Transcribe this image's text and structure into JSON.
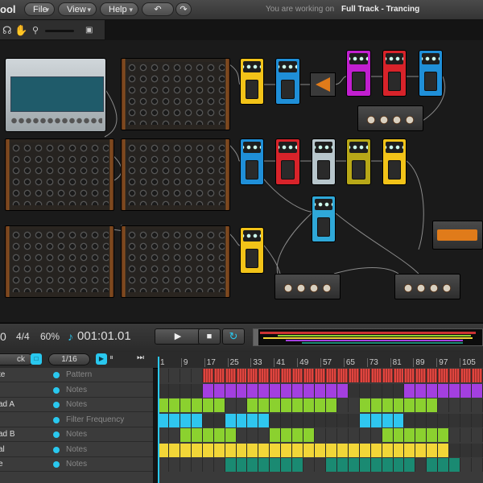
{
  "app": {
    "name": "ool"
  },
  "menu": {
    "file": "File",
    "view": "View",
    "help": "Help",
    "undo_icon": "undo-icon",
    "redo_icon": "redo-icon"
  },
  "status": {
    "prefix": "You are working on",
    "track": "Full Track - Trancing"
  },
  "tools": {
    "icons": [
      "headphones-icon",
      "hand-icon",
      "zoom-icon",
      "trash-icon"
    ]
  },
  "devices": {
    "synth_label": "—",
    "colors": {
      "yellow": "#f2c318",
      "blue": "#1f8fd8",
      "red": "#d8232a",
      "magenta": "#c21fd0",
      "orange": "#e07b1a",
      "cyan": "#2fa8d8",
      "olive": "#b8a818",
      "silver": "#b8c6cc"
    }
  },
  "transport": {
    "position_prefix": "0",
    "signature": "4/4",
    "zoom": "60%",
    "time": "001:01.01",
    "play_icon": "play-icon",
    "stop_icon": "stop-icon",
    "loop_icon": "loop-icon"
  },
  "seqbar": {
    "back_label": "ck",
    "grid_value": "1/16",
    "follow_icon": "follow-icon",
    "skip_icon": "skip-icon"
  },
  "ruler": [
    "1",
    "9",
    "17",
    "25",
    "33",
    "41",
    "49",
    "57",
    "65",
    "73",
    "81",
    "89",
    "97",
    "105"
  ],
  "tracks": [
    {
      "name": "te",
      "param": "Pattern",
      "color": "#e0453f"
    },
    {
      "name": "",
      "param": "Notes",
      "color": "#a33fe0"
    },
    {
      "name": "ad A",
      "param": "Notes",
      "color": "#8bd12f"
    },
    {
      "name": "",
      "param": "Filter Frequency",
      "color": "#2fc6ef"
    },
    {
      "name": "ad B",
      "param": "Notes",
      "color": "#8bd12f"
    },
    {
      "name": "al",
      "param": "Notes",
      "color": "#f2d638"
    },
    {
      "name": "e",
      "param": "Notes",
      "color": "#1a8a72"
    }
  ],
  "caption": ""
}
